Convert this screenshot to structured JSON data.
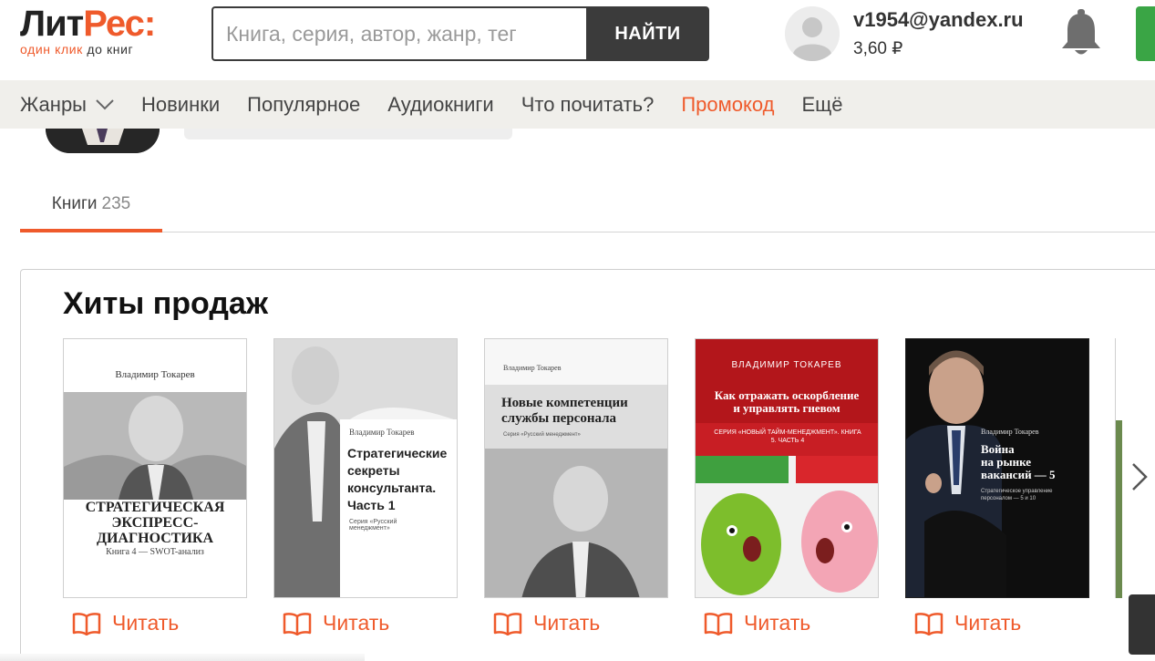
{
  "header": {
    "logo_part1": "Лит",
    "logo_part2": "Рес:",
    "tagline_accent": "один клик",
    "tagline_rest": " до книг",
    "search_placeholder": "Книга, серия, автор, жанр, тег",
    "search_button": "НАЙТИ",
    "user_email": "v1954@yandex.ru",
    "user_balance": "3,60 ₽"
  },
  "nav": {
    "items": [
      "Жанры",
      "Новинки",
      "Популярное",
      "Аудиокниги",
      "Что почитать?",
      "Промокод",
      "Ещё"
    ]
  },
  "tabs": {
    "books_label": "Книги",
    "books_count": "235"
  },
  "shelf": {
    "title": "Хиты продаж",
    "read_label": "Читать",
    "books": [
      {
        "author": "Владимир Токарев",
        "title_lines": [
          "СТРАТЕГИЧЕСКАЯ",
          "ЭКСПРЕСС-",
          "ДИАГНОСТИКА"
        ],
        "subtitle": "Книга 4 — SWOT-анализ"
      },
      {
        "author": "Владимир Токарев",
        "title_lines": [
          "Стратегические",
          "секреты",
          "консультанта.",
          "Часть 1"
        ],
        "subtitle": "Серия «Русский менеджмент»"
      },
      {
        "author": "Владимир Токарев",
        "title_lines": [
          "Новые компетенции",
          "службы персонала"
        ],
        "subtitle": "Серия «Русский менеджмент»"
      },
      {
        "author": "ВЛАДИМИР ТОКАРЕВ",
        "title_lines": [
          "Как отражать оскорбление",
          "и управлять гневом"
        ],
        "subtitle": "СЕРИЯ «НОВЫЙ ТАЙМ-МЕНЕДЖМЕНТ». КНИГА 5. ЧАСТЬ 4"
      },
      {
        "author": "Владимир Токарев",
        "title_lines": [
          "Война",
          "на рынке",
          "вакансий — 5"
        ],
        "subtitle": "Стратегическое управление персоналом — 5 и 10"
      }
    ]
  },
  "colors": {
    "accent": "#ef5a2b",
    "nav_bg": "#f0efeb",
    "search_button_bg": "#3b3b3b",
    "green_button": "#3aa545"
  },
  "icons": {
    "read": "open-book-icon",
    "bell": "bell-icon",
    "avatar": "user-silhouette-icon",
    "next": "chevron-right-icon",
    "dropdown": "chevron-down-icon"
  }
}
